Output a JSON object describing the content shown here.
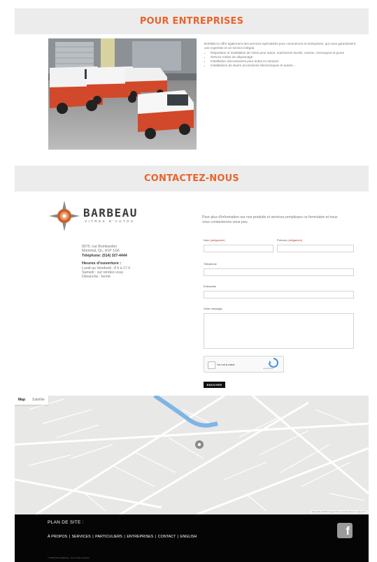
{
  "business": {
    "heading": "POUR ENTREPRISES",
    "intro": "BARBEAU offre également des services spécialisés pour commerces et entreprises, qui vous garantissent une expertise et un service intégral.",
    "services": [
      "Réparation et installation de vitres pour autos, machinerie lourde, camion, remorques et grues",
      "Service routier de dépannage",
      "Installation d'accessoires pour autos et camions",
      "Installations de divers accessoires électroniques et autres..."
    ]
  },
  "contact": {
    "heading": "CONTACTEZ-NOUS",
    "brand": "BARBEAU",
    "brand_sub": "VITRES D'AUTOS",
    "address_line1": "8975, rue Bombardier",
    "address_line2": "Montréal, Qc, H1P 1G6",
    "phone": "Téléphone: (514) 327-4444",
    "hours_title": "Heures d'ouverture :",
    "hours": [
      "Lundi au Vendredi : 8 h à 17 h",
      "Samedi : sur rendez-vous",
      "Dimanche : fermé"
    ],
    "form_intro": "Pour plus d'information sur nos produits et services,remplissez ce formulaire et nous vous contacterons sous peu.",
    "form": {
      "name_label": "Nom",
      "firstname_label": "Prénom",
      "required_mark": "(obligatoire)",
      "phone_label": "Téléphone",
      "company_label": "Entreprise",
      "message_label": "Votre message",
      "captcha_label": "I'm not a robot",
      "captcha_brand": "reCAPTCHA",
      "submit_label": "ENVOYER"
    }
  },
  "map": {
    "tab_map": "Map",
    "tab_satellite": "Satellite",
    "attribution": "Map data ©2018 Google   Terms of Use   Report a map error"
  },
  "footer": {
    "plan_title": "PLAN DE SITE :",
    "links": [
      "À PROPOS",
      "SERVICES",
      "PARTICULIERS",
      "ENTREPRISES",
      "CONTACT",
      "ENGLISH"
    ],
    "separator": "|",
    "copyright": "© 2018 Vitres Barbeau · Tous droits réservés",
    "facebook_glyph": "f"
  },
  "colors": {
    "accent": "#e8642c",
    "footer_bg": "#050505",
    "band_bg": "#ececec"
  }
}
